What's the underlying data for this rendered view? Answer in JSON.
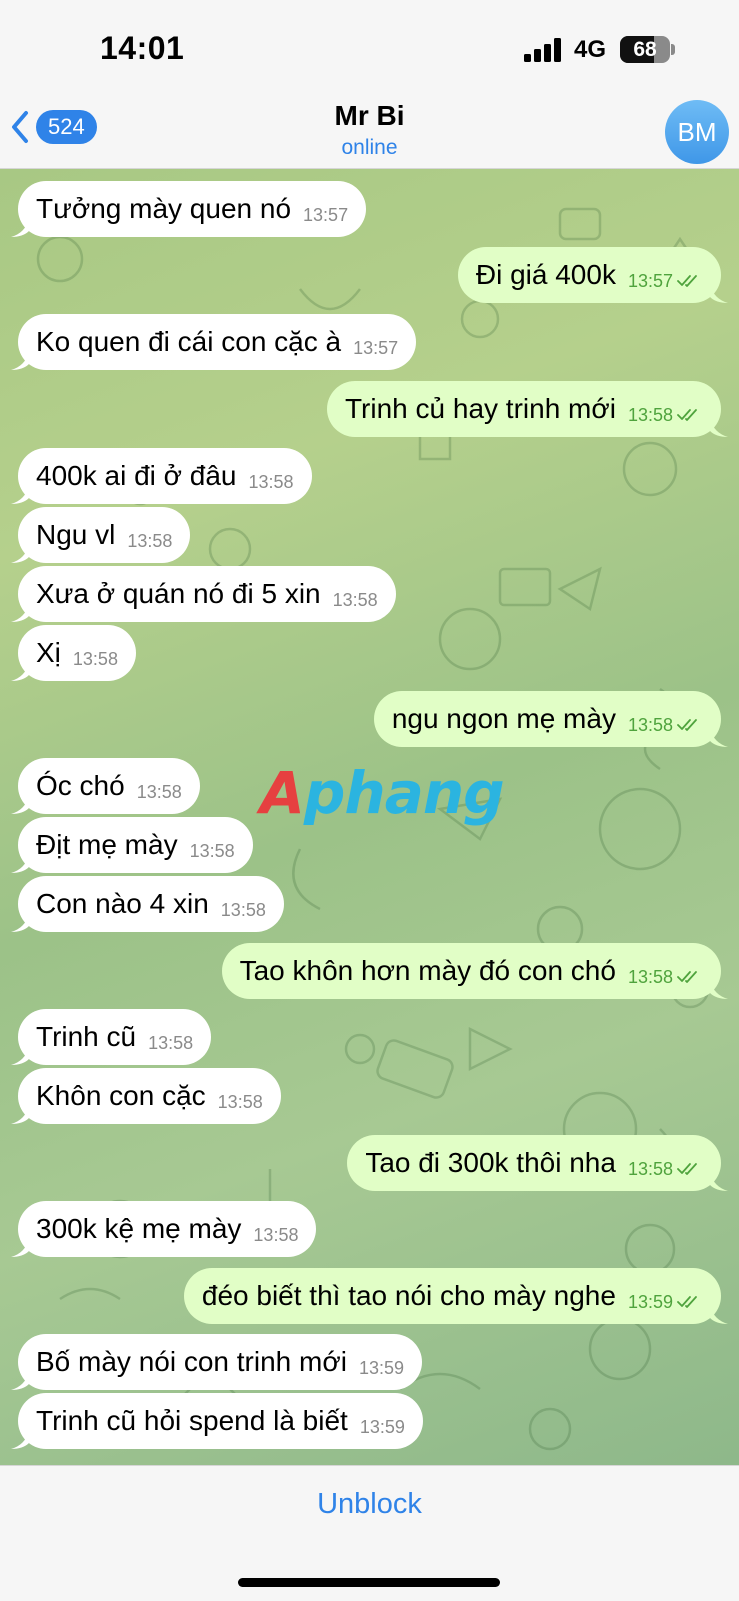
{
  "status": {
    "time": "14:01",
    "network": "4G",
    "battery": "68",
    "battery_level": 0.68
  },
  "header": {
    "back_count": "524",
    "title": "Mr Bi",
    "subtitle": "online",
    "avatar_initials": "BM"
  },
  "watermark": {
    "part1": "A",
    "part2": "phang"
  },
  "messages": [
    {
      "dir": "in",
      "text": "Tưởng mày quen nó",
      "time": "13:57"
    },
    {
      "dir": "out",
      "text": "Đi giá 400k",
      "time": "13:57"
    },
    {
      "dir": "in",
      "text": "Ko quen đi cái con cặc à",
      "time": "13:57"
    },
    {
      "dir": "out",
      "text": "Trinh củ hay trinh mới",
      "time": "13:58"
    },
    {
      "dir": "in",
      "text": "400k ai đi ở đâu",
      "time": "13:58"
    },
    {
      "dir": "in",
      "text": "Ngu vl",
      "time": "13:58"
    },
    {
      "dir": "in",
      "text": "Xưa ở quán nó đi 5 xin",
      "time": "13:58"
    },
    {
      "dir": "in",
      "text": "Xị",
      "time": "13:58"
    },
    {
      "dir": "out",
      "text": "ngu ngon mẹ mày",
      "time": "13:58"
    },
    {
      "dir": "in",
      "text": "Óc chó",
      "time": "13:58"
    },
    {
      "dir": "in",
      "text": "Địt mẹ mày",
      "time": "13:58"
    },
    {
      "dir": "in",
      "text": "Con nào 4 xin",
      "time": "13:58"
    },
    {
      "dir": "out",
      "text": "Tao khôn hơn mày đó con chó",
      "time": "13:58"
    },
    {
      "dir": "in",
      "text": "Trinh cũ",
      "time": "13:58"
    },
    {
      "dir": "in",
      "text": "Khôn con cặc",
      "time": "13:58"
    },
    {
      "dir": "out",
      "text": "Tao đi 300k thôi nha",
      "time": "13:58"
    },
    {
      "dir": "in",
      "text": "300k kệ mẹ mày",
      "time": "13:58"
    },
    {
      "dir": "out",
      "text": "đéo biết thì tao nói cho mày nghe",
      "time": "13:59"
    },
    {
      "dir": "in",
      "text": "Bố mày nói con trinh mới",
      "time": "13:59"
    },
    {
      "dir": "in",
      "text": "Trinh cũ hỏi spend là biết",
      "time": "13:59"
    }
  ],
  "bottom": {
    "unblock_label": "Unblock"
  },
  "colors": {
    "accent": "#2f83e8",
    "outgoing_bubble": "#e1fec6",
    "incoming_bubble": "#ffffff",
    "read_tick": "#4fa33d"
  },
  "icons": {
    "back": "chevron-left-icon",
    "scroll": "chevron-down-icon",
    "read": "double-check-icon"
  }
}
